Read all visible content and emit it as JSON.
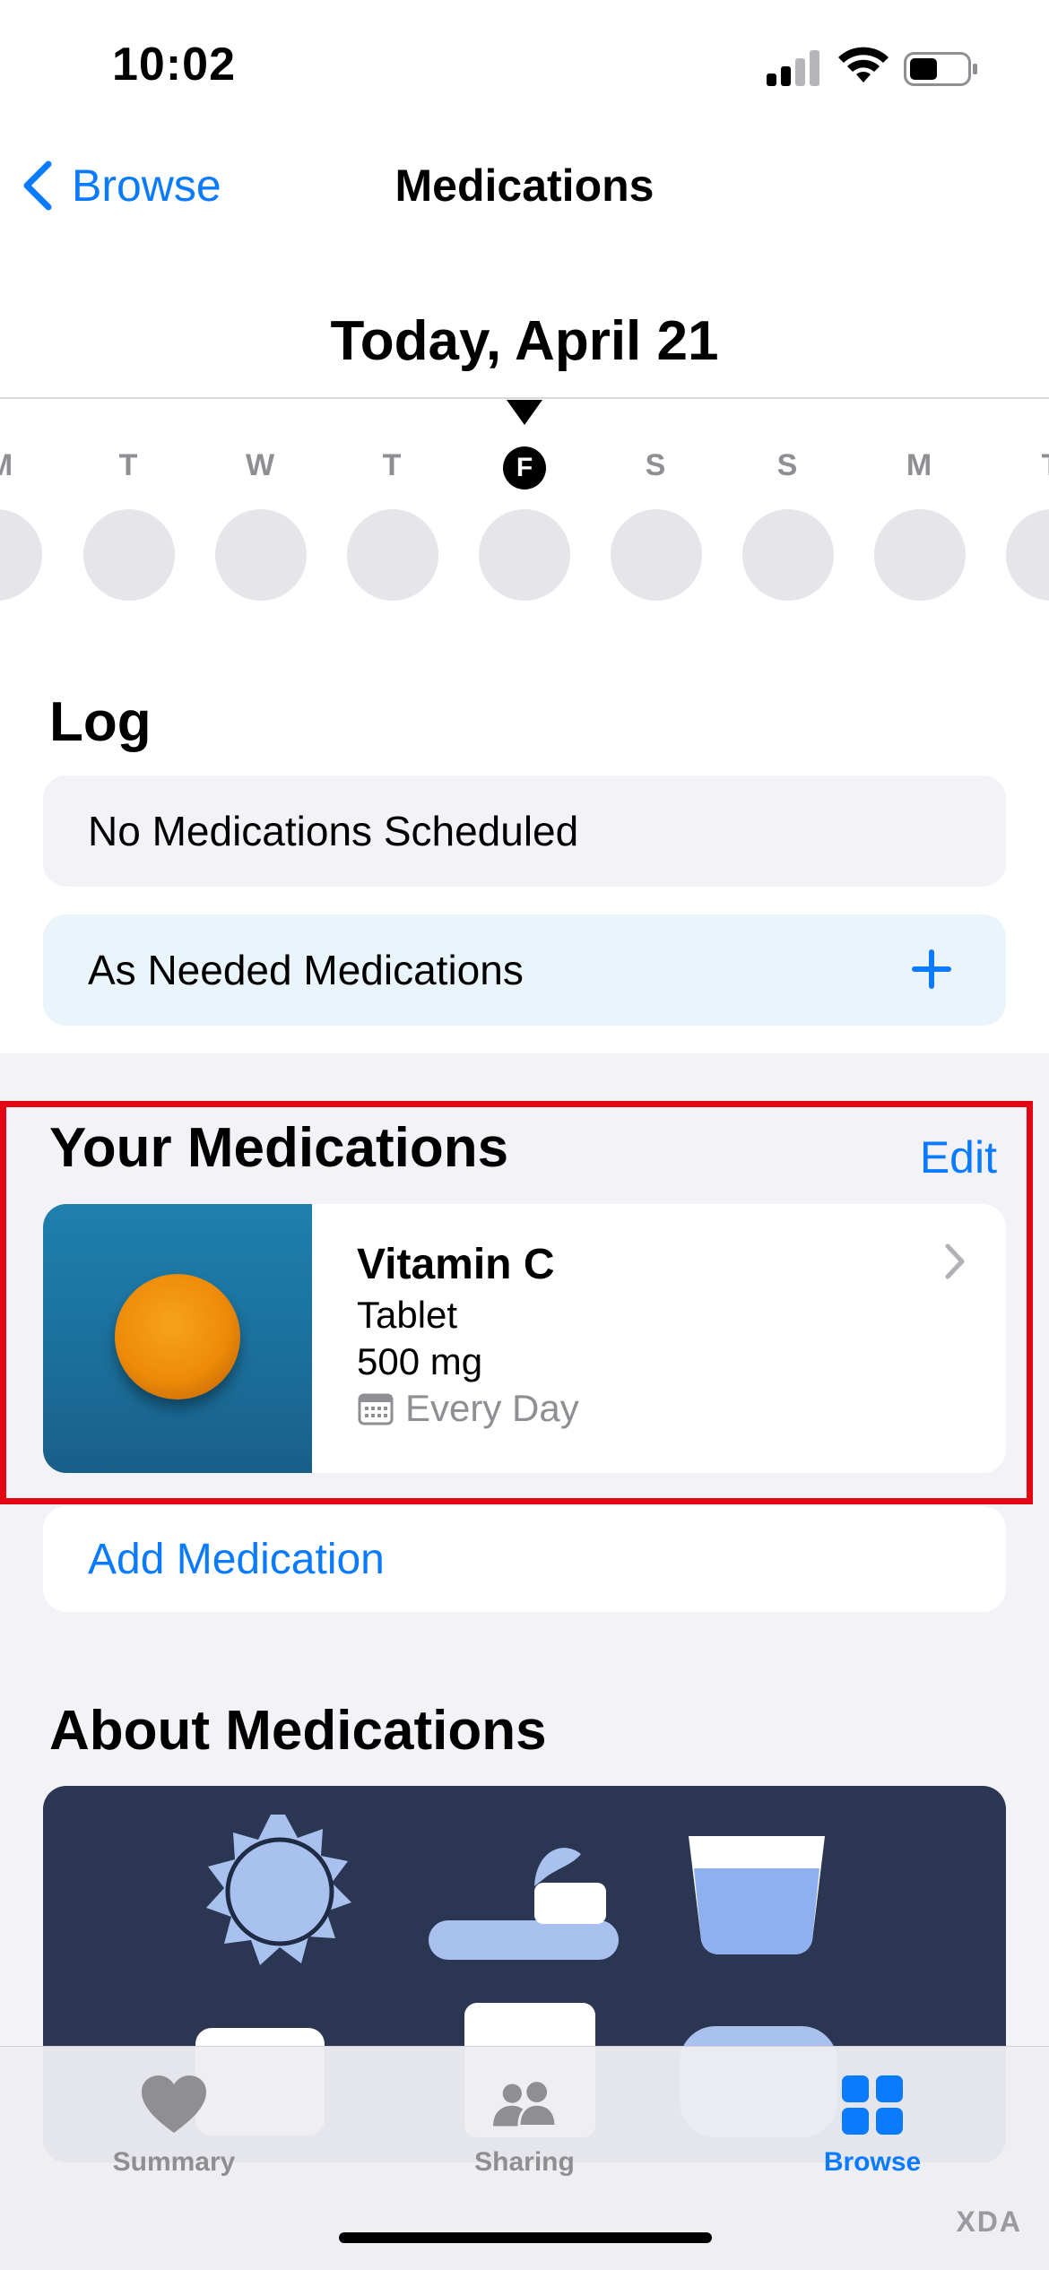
{
  "status_bar": {
    "time": "10:02"
  },
  "nav": {
    "back_label": "Browse",
    "title": "Medications"
  },
  "date_header": {
    "title": "Today, April 21",
    "days": [
      "M",
      "T",
      "W",
      "T",
      "F",
      "S",
      "S",
      "M",
      "T"
    ],
    "selected_day": "F"
  },
  "log": {
    "title": "Log",
    "scheduled_text": "No Medications Scheduled",
    "as_needed_text": "As Needed Medications"
  },
  "your_medications": {
    "title": "Your Medications",
    "edit_label": "Edit",
    "items": [
      {
        "name": "Vitamin C",
        "form": "Tablet",
        "dose": "500 mg",
        "schedule": "Every Day",
        "pill_color": "#ee8b09",
        "thumb_color": "#1b6e9a"
      }
    ],
    "add_label": "Add Medication"
  },
  "about": {
    "title": "About Medications"
  },
  "tab_bar": {
    "tabs": [
      {
        "label": "Summary",
        "icon": "heart-icon"
      },
      {
        "label": "Sharing",
        "icon": "people-icon"
      },
      {
        "label": "Browse",
        "icon": "grid-icon"
      }
    ],
    "active": "Browse"
  },
  "watermark": "XDA",
  "colors": {
    "accent": "#0a7aff",
    "highlight": "#e30613"
  }
}
